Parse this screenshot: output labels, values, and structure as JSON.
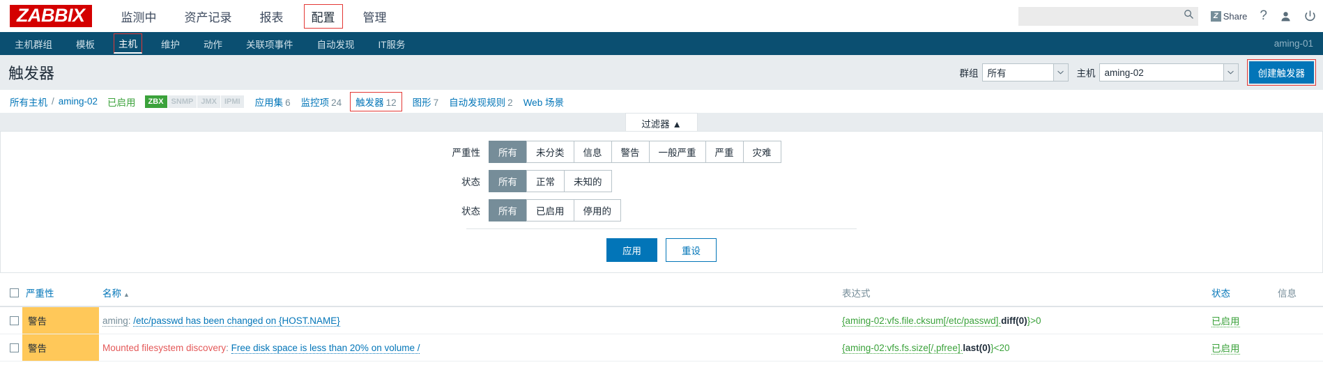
{
  "brand": {
    "logo": "ZABBIX"
  },
  "mainnav": {
    "items": [
      {
        "label": "监测中",
        "selected": false
      },
      {
        "label": "资产记录",
        "selected": false
      },
      {
        "label": "报表",
        "selected": false
      },
      {
        "label": "配置",
        "selected": true
      },
      {
        "label": "管理",
        "selected": false
      }
    ]
  },
  "topright": {
    "search_placeholder": "",
    "search_value": "",
    "search_icon": "search-icon",
    "share_badge": "Z",
    "share_label": "Share",
    "help_icon": "?",
    "user_icon": "user-icon",
    "power_icon": "power-icon"
  },
  "subnav": {
    "items": [
      {
        "label": "主机群组",
        "selected": false
      },
      {
        "label": "模板",
        "selected": false
      },
      {
        "label": "主机",
        "selected": true
      },
      {
        "label": "维护",
        "selected": false
      },
      {
        "label": "动作",
        "selected": false
      },
      {
        "label": "关联项事件",
        "selected": false
      },
      {
        "label": "自动发现",
        "selected": false
      },
      {
        "label": "IT服务",
        "selected": false
      }
    ],
    "user": "aming-01"
  },
  "page": {
    "title": "触发器",
    "group_label": "群组",
    "group_value": "所有",
    "host_label": "主机",
    "host_value": "aming-02",
    "create_button": "创建触发器"
  },
  "breadcrumb": {
    "all_hosts": "所有主机",
    "separator": "/",
    "host": "aming-02",
    "enabled": "已启用",
    "protocols": [
      {
        "label": "ZBX",
        "active": true
      },
      {
        "label": "SNMP",
        "active": false
      },
      {
        "label": "JMX",
        "active": false
      },
      {
        "label": "IPMI",
        "active": false
      }
    ],
    "links": [
      {
        "label": "应用集",
        "count": "6",
        "selected": false
      },
      {
        "label": "监控项",
        "count": "24",
        "selected": false
      },
      {
        "label": "触发器",
        "count": "12",
        "selected": true
      },
      {
        "label": "图形",
        "count": "7",
        "selected": false
      },
      {
        "label": "自动发现规则",
        "count": "2",
        "selected": false
      },
      {
        "label": "Web 场景",
        "count": "",
        "selected": false
      }
    ]
  },
  "filter": {
    "tab_label": "过滤器 ▲",
    "rows": [
      {
        "label": "严重性",
        "options": [
          "所有",
          "未分类",
          "信息",
          "警告",
          "一般严重",
          "严重",
          "灾难"
        ],
        "active": 0
      },
      {
        "label": "状态",
        "options": [
          "所有",
          "正常",
          "未知的"
        ],
        "active": 0
      },
      {
        "label": "状态",
        "options": [
          "所有",
          "已启用",
          "停用的"
        ],
        "active": 0
      }
    ],
    "apply_label": "应用",
    "reset_label": "重设"
  },
  "table": {
    "headers": {
      "severity": "严重性",
      "name": "名称",
      "name_sort": "▲",
      "expression": "表达式",
      "status": "状态",
      "info": "信息"
    },
    "rows": [
      {
        "severity": "警告",
        "severity_color": "#ffc859",
        "prefix": "aming",
        "prefix_style": "gray",
        "name": "/etc/passwd has been changed on {HOST.NAME}",
        "expr_pre": "{aming-02:vfs.file.cksum[/etc/passwd].",
        "expr_fn": "diff(0)",
        "expr_post": "}>0",
        "status": "已启用",
        "info": ""
      },
      {
        "severity": "警告",
        "severity_color": "#ffc859",
        "prefix": "Mounted filesystem discovery",
        "prefix_style": "red",
        "name": "Free disk space is less than 20% on volume /",
        "expr_pre": "{aming-02:vfs.fs.size[/,pfree].",
        "expr_fn": "last(0)",
        "expr_post": "}<20",
        "status": "已启用",
        "info": ""
      }
    ]
  },
  "colors": {
    "brand_red": "#d40000",
    "nav_blue": "#0b4f71",
    "link_blue": "#0275b8",
    "green": "#3ba23b",
    "warning_orange": "#ffc859",
    "highlight_red": "#e33734"
  }
}
